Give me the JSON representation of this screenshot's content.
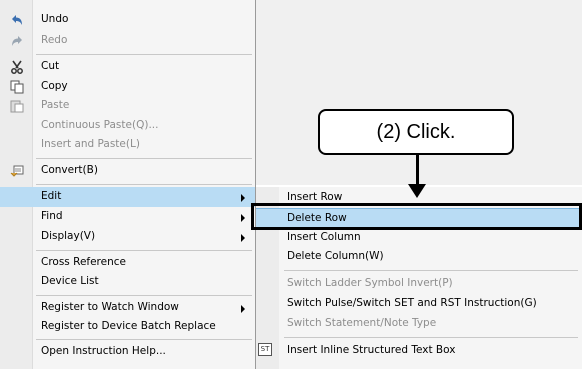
{
  "menu": {
    "items": [
      {
        "label": "Undo",
        "icon": "undo-icon",
        "enabled": true
      },
      {
        "label": "Redo",
        "icon": "redo-icon",
        "enabled": false
      },
      {
        "label": "Cut",
        "icon": "cut-icon",
        "enabled": true
      },
      {
        "label": "Copy",
        "icon": "copy-icon",
        "enabled": true
      },
      {
        "label": "Paste",
        "icon": "paste-icon",
        "enabled": false
      },
      {
        "label": "Continuous Paste(Q)...",
        "enabled": false
      },
      {
        "label": "Insert and Paste(L)",
        "enabled": false
      },
      {
        "label": "Convert(B)",
        "icon": "convert-icon",
        "enabled": true
      },
      {
        "label": "Edit",
        "submenu": true,
        "selected": true
      },
      {
        "label": "Find",
        "submenu": true
      },
      {
        "label": "Display(V)",
        "submenu": true
      },
      {
        "label": "Cross Reference",
        "enabled": true
      },
      {
        "label": "Device List",
        "enabled": true
      },
      {
        "label": "Register to Watch Window",
        "submenu": true
      },
      {
        "label": "Register to Device Batch Replace",
        "enabled": true
      },
      {
        "label": "Open Instruction Help...",
        "enabled": true
      }
    ]
  },
  "submenu": {
    "items": [
      {
        "label": "Insert Row",
        "enabled": true
      },
      {
        "label": "Delete Row",
        "selected": true
      },
      {
        "label": "Insert Column",
        "enabled": true
      },
      {
        "label": "Delete Column(W)",
        "enabled": true
      },
      {
        "label": "Switch Ladder Symbol Invert(P)",
        "enabled": false
      },
      {
        "label": "Switch Pulse/Switch SET and RST Instruction(G)",
        "enabled": true
      },
      {
        "label": "Switch Statement/Note Type",
        "enabled": false
      },
      {
        "label": "Insert Inline Structured Text Box",
        "icon": "st-box-icon",
        "enabled": true
      }
    ],
    "st_icon_text": "ST"
  },
  "callout": {
    "text": "(2) Click."
  },
  "colors": {
    "selection": "#b9dcf4",
    "disabled_text": "#8d8d8d",
    "accent_frame": "#000000"
  }
}
